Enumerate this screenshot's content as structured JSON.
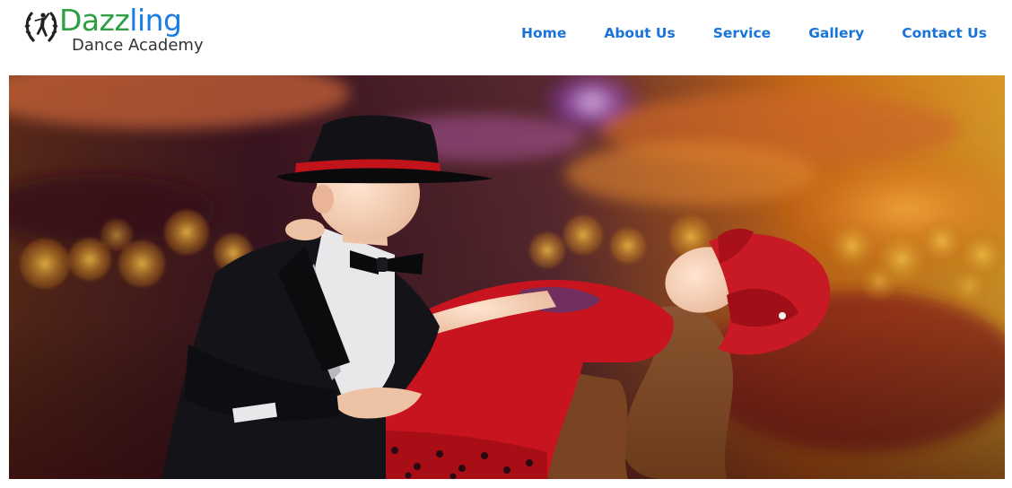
{
  "brand": {
    "title_a": "Dazz",
    "title_b": "ling",
    "subtitle": "Dance Academy",
    "logo_icon": "dancer-laurel-emblem-icon",
    "colors": {
      "green": "#2ea043",
      "blue": "#1a7de6"
    }
  },
  "nav": {
    "items": [
      {
        "label": "Home"
      },
      {
        "label": "About Us"
      },
      {
        "label": "Service"
      },
      {
        "label": "Gallery"
      },
      {
        "label": "Contact Us"
      }
    ],
    "color": "#1a73d9"
  },
  "hero": {
    "image": "two-children-dancing-photo",
    "description_colors": [
      "#c81a1a",
      "#f0a020",
      "#3a1a40"
    ]
  }
}
